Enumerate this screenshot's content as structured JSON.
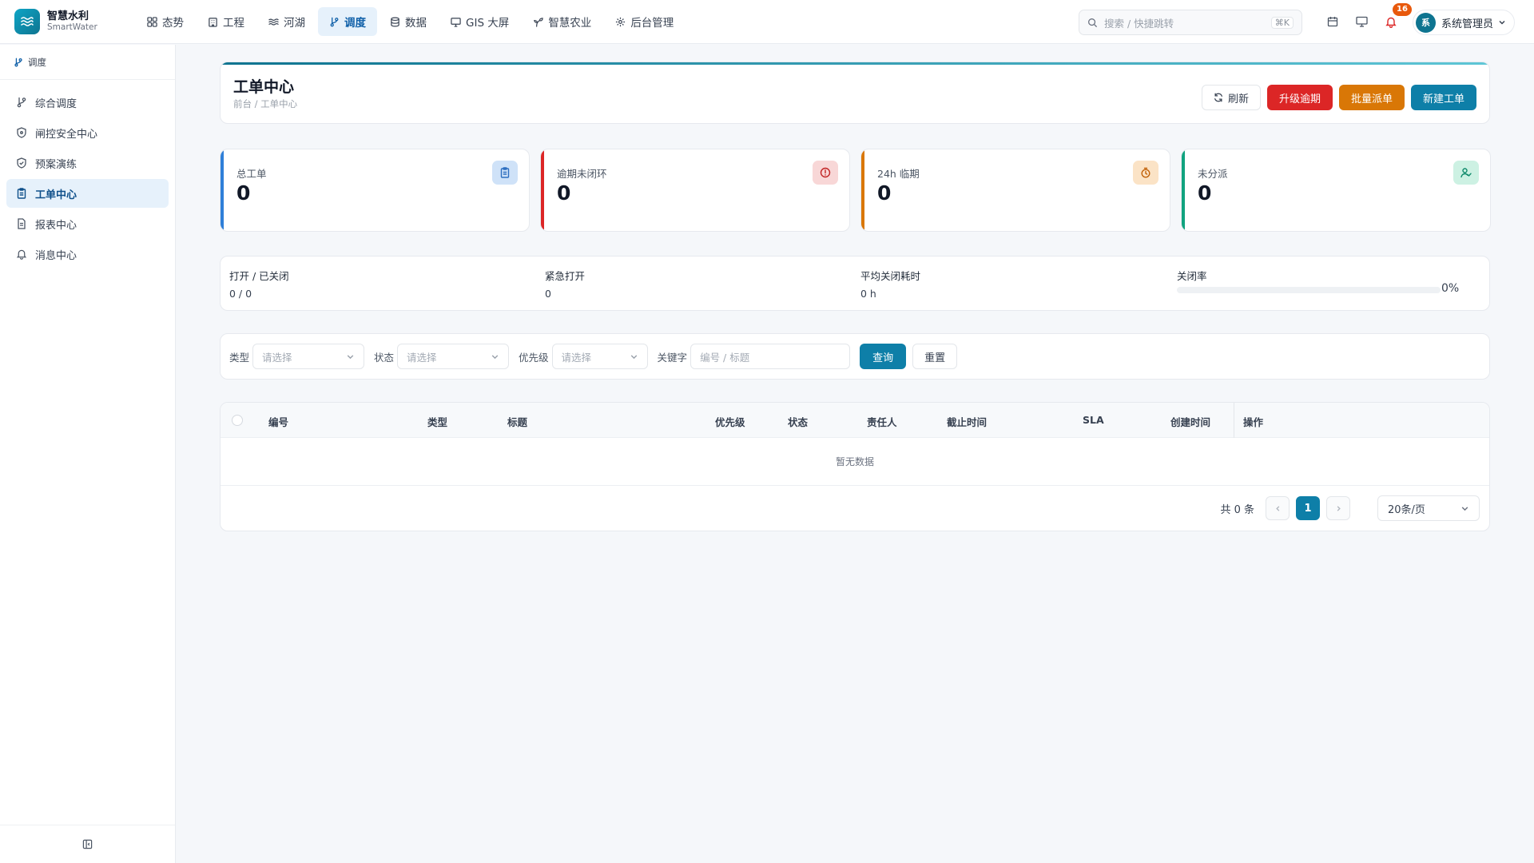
{
  "app": {
    "name": "智慧水利",
    "subtitle": "SmartWater"
  },
  "nav": [
    {
      "label": "态势",
      "icon": "grid-icon"
    },
    {
      "label": "工程",
      "icon": "building-icon"
    },
    {
      "label": "河湖",
      "icon": "waves-icon"
    },
    {
      "label": "调度",
      "icon": "git-branch-icon",
      "active": true
    },
    {
      "label": "数据",
      "icon": "database-icon"
    },
    {
      "label": "GIS 大屏",
      "icon": "monitor-icon"
    },
    {
      "label": "智慧农业",
      "icon": "sprout-icon"
    },
    {
      "label": "后台管理",
      "icon": "gear-icon"
    }
  ],
  "search": {
    "placeholder": "搜索 / 快捷跳转",
    "shortcut": "⌘K"
  },
  "header": {
    "notification_count": "16",
    "user_avatar_text": "系",
    "user_name": "系统管理员"
  },
  "sidebar": {
    "title": "调度",
    "items": [
      {
        "label": "综合调度",
        "icon": "git-branch-icon"
      },
      {
        "label": "闸控安全中心",
        "icon": "shield-icon"
      },
      {
        "label": "预案演练",
        "icon": "shield-check-icon"
      },
      {
        "label": "工单中心",
        "icon": "clipboard-icon",
        "active": true
      },
      {
        "label": "报表中心",
        "icon": "file-text-icon"
      },
      {
        "label": "消息中心",
        "icon": "bell-icon"
      }
    ]
  },
  "page": {
    "title": "工单中心",
    "breadcrumb": "前台 / 工单中心",
    "actions": {
      "refresh": "刷新",
      "escalate": "升级逾期",
      "batch_dispatch": "批量派单",
      "create": "新建工单"
    }
  },
  "stats": [
    {
      "label": "总工单",
      "value": "0",
      "color": "#2f7fd8",
      "icon": "clipboard-icon"
    },
    {
      "label": "逾期未闭环",
      "value": "0",
      "color": "#dc2626",
      "icon": "alert-circle-icon"
    },
    {
      "label": "24h 临期",
      "value": "0",
      "color": "#d97706",
      "icon": "timer-icon"
    },
    {
      "label": "未分派",
      "value": "0",
      "color": "#10a37f",
      "icon": "user-check-icon"
    }
  ],
  "summary": {
    "open_closed_label": "打开 / 已关闭",
    "open_closed_value": "0 / 0",
    "urgent_label": "紧急打开",
    "urgent_value": "0",
    "avg_close_label": "平均关闭耗时",
    "avg_close_value": "0 h",
    "close_rate_label": "关闭率",
    "close_rate_value": "0%",
    "close_rate": 0
  },
  "filters": {
    "type_label": "类型",
    "status_label": "状态",
    "priority_label": "优先级",
    "keyword_label": "关键字",
    "select_placeholder": "请选择",
    "keyword_placeholder": "编号 / 标题",
    "query": "查询",
    "reset": "重置"
  },
  "table": {
    "columns": [
      "编号",
      "类型",
      "标题",
      "优先级",
      "状态",
      "责任人",
      "截止时间",
      "SLA",
      "创建时间",
      "操作"
    ],
    "rows": [],
    "empty_text": "暂无数据"
  },
  "pagination": {
    "total_text": "共 0 条",
    "current_page": "1",
    "page_size": "20条/页"
  }
}
